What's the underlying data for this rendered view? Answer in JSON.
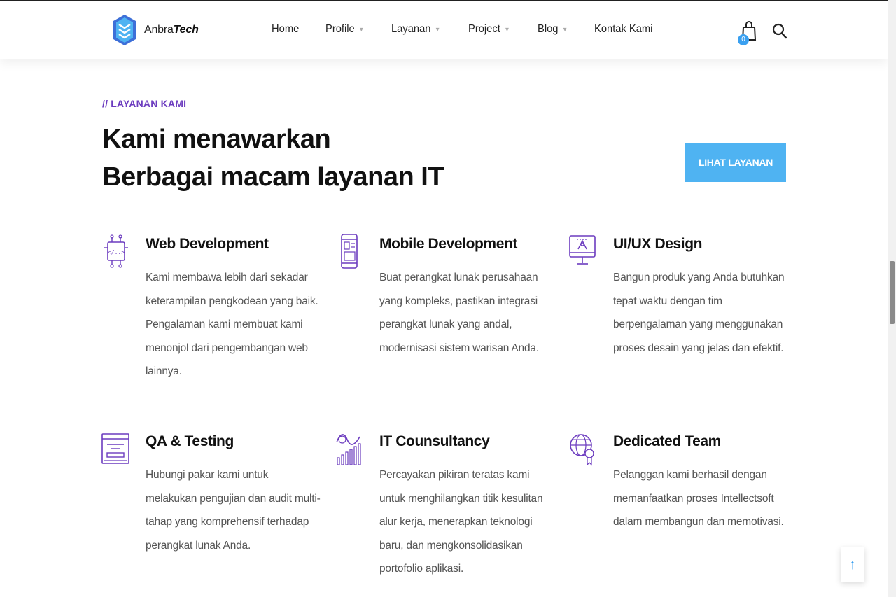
{
  "brand": {
    "name_regular": "Anbra",
    "name_bold": "Tech",
    "accent": "#6c3cbf",
    "primary": "#4fb3f2"
  },
  "nav": {
    "items": [
      {
        "label": "Home",
        "has_dropdown": false
      },
      {
        "label": "Profile",
        "has_dropdown": true
      },
      {
        "label": "Layanan",
        "has_dropdown": true
      },
      {
        "label": "Project",
        "has_dropdown": true
      },
      {
        "label": "Blog",
        "has_dropdown": true
      },
      {
        "label": "Kontak Kami",
        "has_dropdown": false
      }
    ],
    "cart_count": "0"
  },
  "section": {
    "eyebrow": "// LAYANAN KAMI",
    "headline_line1": "Kami menawarkan",
    "headline_line2": "Berbagai macam layanan IT",
    "cta_label": "LIHAT LAYANAN"
  },
  "services": [
    {
      "title": "Web Development",
      "icon": "web-code-icon",
      "description": "Kami membawa lebih dari sekadar keterampilan pengkodean yang baik. Pengalaman kami membuat kami menonjol dari pengembangan web lainnya."
    },
    {
      "title": "Mobile Development",
      "icon": "mobile-phone-icon",
      "description": "Buat perangkat lunak perusahaan yang kompleks, pastikan integrasi perangkat lunak yang andal, modernisasi sistem warisan Anda."
    },
    {
      "title": "UI/UX Design",
      "icon": "design-monitor-icon",
      "description": "Bangun produk yang Anda butuhkan tepat waktu dengan tim berpengalaman yang menggunakan proses desain yang jelas dan efektif."
    },
    {
      "title": "QA & Testing",
      "icon": "testing-window-icon",
      "description": "Hubungi pakar kami untuk melakukan pengujian dan audit multi-tahap yang komprehensif terhadap perangkat lunak Anda."
    },
    {
      "title": "IT Counsultancy",
      "icon": "analytics-chart-icon",
      "description": "Percayakan pikiran teratas kami untuk menghilangkan titik kesulitan alur kerja, menerapkan teknologi baru, dan mengkonsolidasikan portofolio aplikasi."
    },
    {
      "title": "Dedicated Team",
      "icon": "global-team-icon",
      "description": "Pelanggan kami berhasil dengan memanfaatkan proses Intellectsoft dalam membangun dan memotivasi."
    }
  ]
}
